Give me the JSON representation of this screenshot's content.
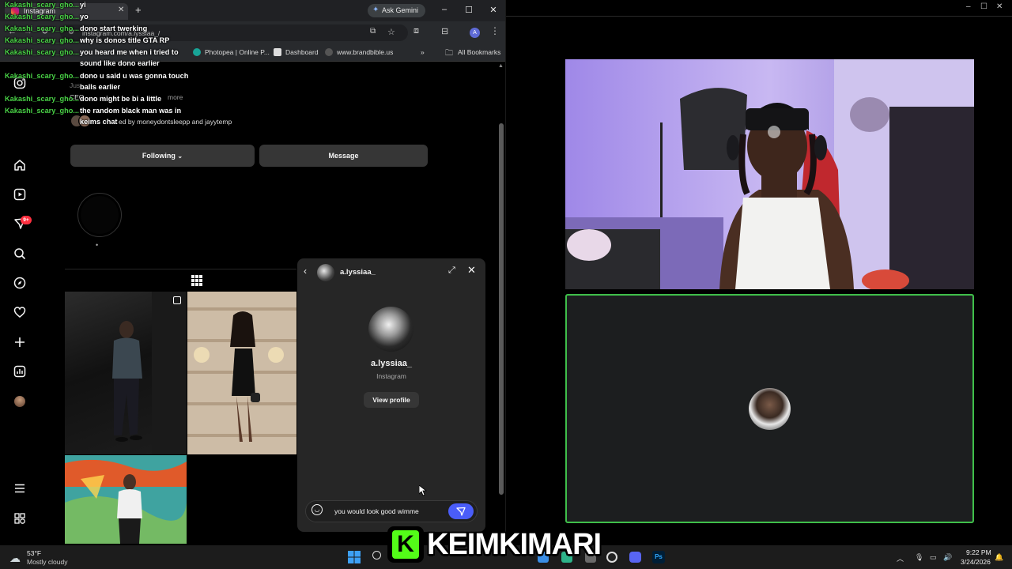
{
  "browser": {
    "tab_title": "Instagram",
    "new_tab": "+",
    "ask_gemini": "Ask Gemini",
    "url": "instagram.com/a.lyssiaa_/",
    "profile_initial": "A",
    "bookmarks": [
      "Photopea | Online P...",
      "Dashboard",
      "www.brandbible.us"
    ],
    "all_bookmarks": "All Bookmarks",
    "more_bookmarks": "»"
  },
  "chat": [
    {
      "name": "Kakashi_scary_gho...",
      "msg": "yi"
    },
    {
      "name": "Kakashi_scary_gho...",
      "msg": "yo"
    },
    {
      "name": "Kakashi_scary_gho...",
      "msg": "dono start twerking"
    },
    {
      "name": "Kakashi_scary_gho...",
      "msg": "why is donos title GTA RP"
    },
    {
      "name": "Kakashi_scary_gho...",
      "msg": "you heard me when i tried to"
    },
    {
      "name": "",
      "msg": "sound like dono earlier"
    },
    {
      "name": "Kakashi_scary_gho...",
      "msg": "dono u said u was gonna touch"
    },
    {
      "name": "",
      "msg": "balls earlier"
    },
    {
      "name": "Kakashi_scary_gho...",
      "msg": "dono might be bi a little"
    },
    {
      "name": "Kakashi_scary_gho...",
      "msg": "the random black man was in"
    },
    {
      "name": "",
      "msg": "keims chat"
    }
  ],
  "profile": {
    "bio_partial": "Jus",
    "bio_ceo": "CEO",
    "more": "more",
    "followed_by": "ed by moneydontsleepp and jayytemp",
    "following_label": "Following",
    "message_label": "Message",
    "highlight_label": "•"
  },
  "dm": {
    "username": "a.lyssiaa_",
    "display_name": "a.lyssiaa_",
    "subtitle": "Instagram",
    "view_profile": "View profile",
    "input_value": "you would look good wimme"
  },
  "notifications": {
    "badge": "9+"
  },
  "overlay": {
    "logo_letter": "K",
    "streamer_name": "KEIMKIMARI"
  },
  "taskbar": {
    "weather_temp": "53°F",
    "weather_desc": "Mostly cloudy",
    "time": "9:22 PM",
    "date": "3/24/2026"
  },
  "colors": {
    "chat_name": "#49d246",
    "notification_badge": "#ff3040",
    "send_button": "#4a5df9",
    "guest_border": "#3fbf4a",
    "kick_green": "#53fc18"
  }
}
